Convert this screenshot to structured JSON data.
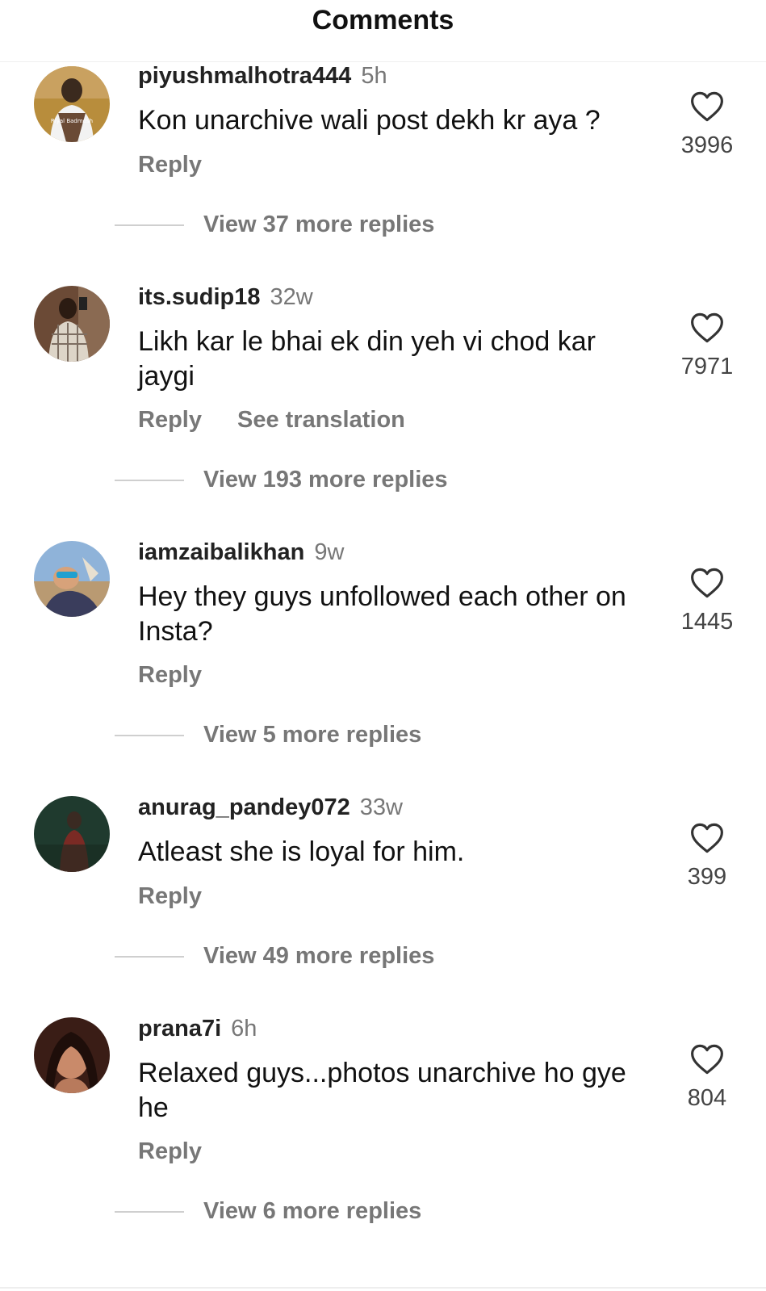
{
  "header": {
    "title": "Comments"
  },
  "comments": [
    {
      "username": "piyushmalhotra444",
      "time": "5h",
      "text": "Kon unarchive wali post dekh kr aya ?",
      "reply": "Reply",
      "translate": "",
      "likes": "3996",
      "view_replies": "View 37 more replies",
      "avatar_caption": "Riyal Badmosh"
    },
    {
      "username": "its.sudip18",
      "time": "32w",
      "text": "Likh kar le bhai ek din yeh vi chod kar jaygi",
      "reply": "Reply",
      "translate": "See translation",
      "likes": "7971",
      "view_replies": "View 193 more replies"
    },
    {
      "username": "iamzaibalikhan",
      "time": "9w",
      "text": "Hey they guys unfollowed each other on Insta?",
      "reply": "Reply",
      "translate": "",
      "likes": "1445",
      "view_replies": "View 5 more replies"
    },
    {
      "username": "anurag_pandey072",
      "time": "33w",
      "text": "Atleast she is loyal for him.",
      "reply": "Reply",
      "translate": "",
      "likes": "399",
      "view_replies": "View 49 more replies"
    },
    {
      "username": "prana7i",
      "time": "6h",
      "text": "Relaxed guys...photos unarchive ho gye he",
      "reply": "Reply",
      "translate": "",
      "likes": "804",
      "view_replies": "View 6 more replies"
    }
  ],
  "icons": {
    "like": "heart-outline-icon"
  },
  "colors": {
    "muted": "#777777",
    "text": "#111111",
    "divider": "#efefef"
  }
}
